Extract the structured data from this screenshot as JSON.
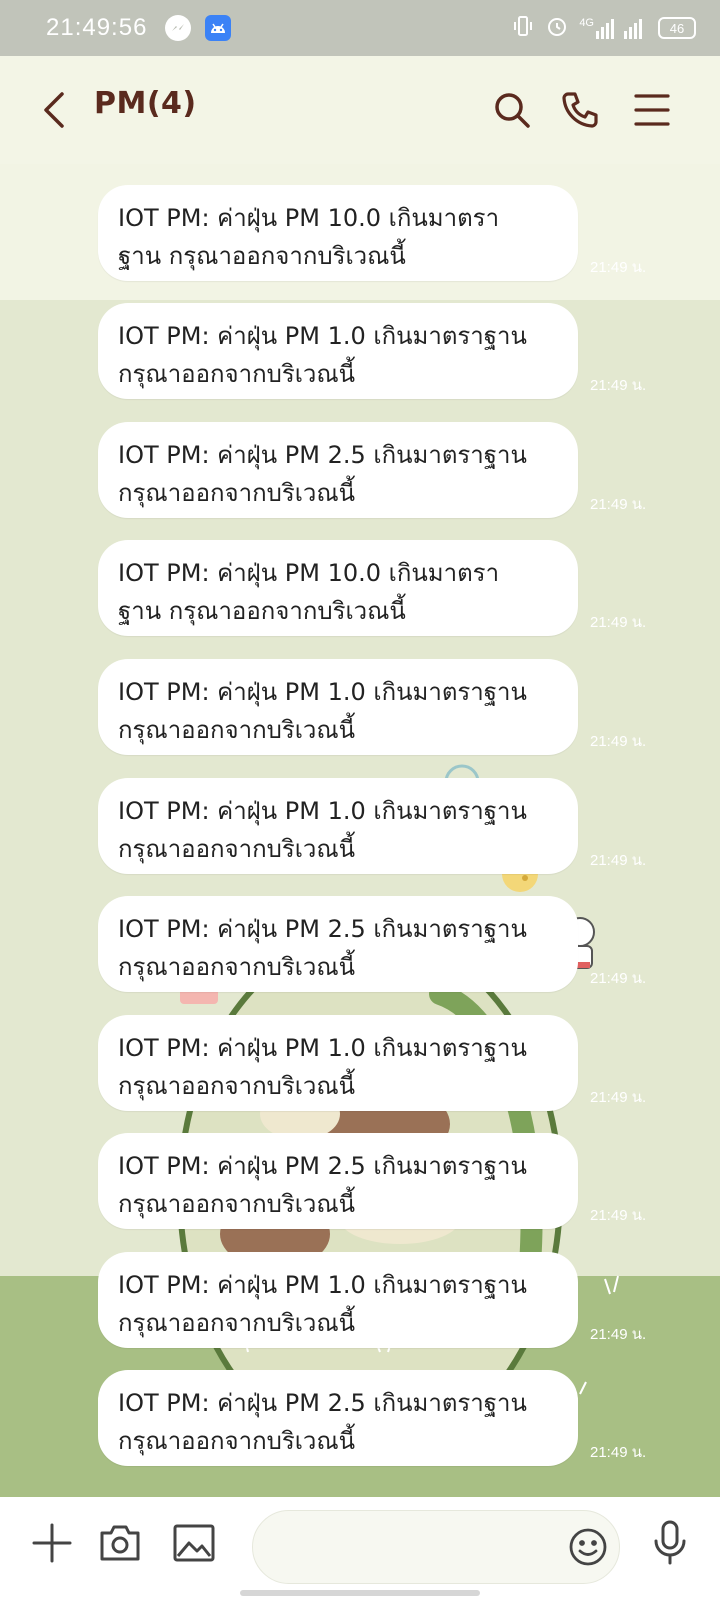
{
  "status_bar": {
    "time": "21:49:56",
    "network": "4G",
    "battery": "46",
    "icons": [
      "messenger-icon",
      "android-icon",
      "vibrate-icon",
      "alarm-icon",
      "signal-icon",
      "battery-icon"
    ]
  },
  "header": {
    "title": "PM(4)",
    "icons": [
      "back-arrow-icon",
      "search-icon",
      "phone-icon",
      "menu-icon"
    ]
  },
  "messages": [
    {
      "text": "IOT PM: ค่าฝุ่น PM 10.0 เกินมาตรา\nฐาน กรุณาออกจากบริเวณนี้",
      "time": "21:49 น."
    },
    {
      "text": "IOT PM: ค่าฝุ่น PM 1.0 เกินมาตราฐาน\nกรุณาออกจากบริเวณนี้",
      "time": "21:49 น."
    },
    {
      "text": "IOT PM: ค่าฝุ่น PM 2.5 เกินมาตราฐาน\nกรุณาออกจากบริเวณนี้",
      "time": "21:49 น."
    },
    {
      "text": "IOT PM: ค่าฝุ่น PM 10.0 เกินมาตรา\nฐาน กรุณาออกจากบริเวณนี้",
      "time": "21:49 น."
    },
    {
      "text": "IOT PM: ค่าฝุ่น PM 1.0 เกินมาตราฐาน\nกรุณาออกจากบริเวณนี้",
      "time": "21:49 น."
    },
    {
      "text": "IOT PM: ค่าฝุ่น PM 1.0 เกินมาตราฐาน\nกรุณาออกจากบริเวณนี้",
      "time": "21:49 น."
    },
    {
      "text": "IOT PM: ค่าฝุ่น PM 2.5 เกินมาตราฐาน\nกรุณาออกจากบริเวณนี้",
      "time": "21:49 น."
    },
    {
      "text": "IOT PM: ค่าฝุ่น PM 1.0 เกินมาตราฐาน\nกรุณาออกจากบริเวณนี้",
      "time": "21:49 น."
    },
    {
      "text": "IOT PM: ค่าฝุ่น PM 2.5 เกินมาตราฐาน\nกรุณาออกจากบริเวณนี้",
      "time": "21:49 น."
    },
    {
      "text": "IOT PM: ค่าฝุ่น PM 1.0 เกินมาตราฐาน\nกรุณาออกจากบริเวณนี้",
      "time": "21:49 น."
    },
    {
      "text": "IOT PM: ค่าฝุ่น PM 2.5 เกินมาตราฐาน\nกรุณาออกจากบริเวณนี้",
      "time": "21:49 น."
    }
  ],
  "input_bar": {
    "value": "",
    "placeholder": "",
    "icons": [
      "plus-icon",
      "camera-icon",
      "image-icon",
      "emoji-icon",
      "microphone-icon"
    ]
  },
  "colors": {
    "header_bg": "#f3f5e6",
    "title": "#5a2a1e",
    "chat_bg": "#e3e8d0",
    "bubble": "#ffffff",
    "status_bar": "#c1c4ba",
    "timestamp": "#ffffff"
  }
}
